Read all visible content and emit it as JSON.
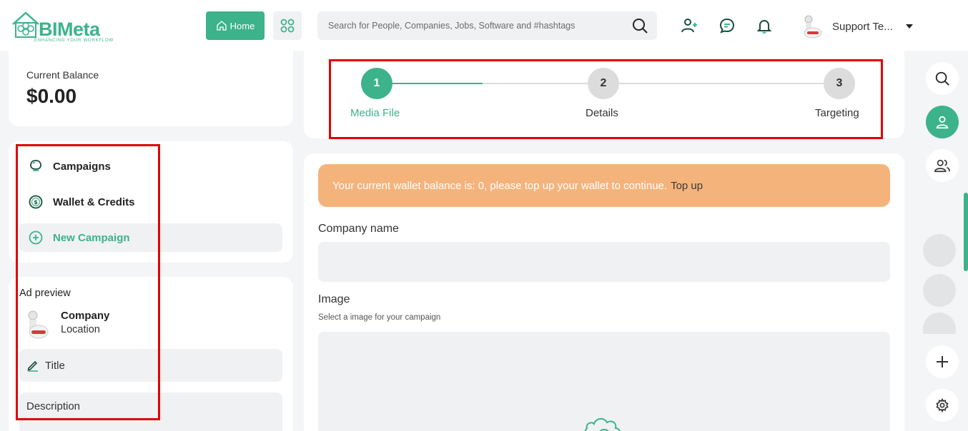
{
  "brand": {
    "name": "BIMeta",
    "tagline": "ENHANCING YOUR WORKFLOW",
    "color": "#3cb38a"
  },
  "header": {
    "home_label": "Home",
    "search_placeholder": "Search for People, Companies, Jobs, Software and #hashtags",
    "user_name": "Support Te..."
  },
  "balance": {
    "label": "Current Balance",
    "value": "$0.00"
  },
  "menu": {
    "items": [
      {
        "label": "Campaigns",
        "icon": "campaign-icon"
      },
      {
        "label": "Wallet & Credits",
        "icon": "dollar-coin-icon"
      },
      {
        "label": "New Campaign",
        "icon": "plus-circle-icon"
      }
    ]
  },
  "preview": {
    "title": "Ad preview",
    "company": "Company",
    "location": "Location",
    "title_field": "Title",
    "description_field": "Description"
  },
  "stepper": {
    "steps": [
      {
        "number": "1",
        "label": "Media File",
        "active": true
      },
      {
        "number": "2",
        "label": "Details",
        "active": false
      },
      {
        "number": "3",
        "label": "Targeting",
        "active": false
      }
    ]
  },
  "form": {
    "alert_text": "Your current wallet balance is: 0, please top up your wallet to continue.",
    "alert_link": "Top up",
    "alert_color": "#f5b37c",
    "company_label": "Company name",
    "image_label": "Image",
    "image_hint": "Select a image for your campaign"
  }
}
